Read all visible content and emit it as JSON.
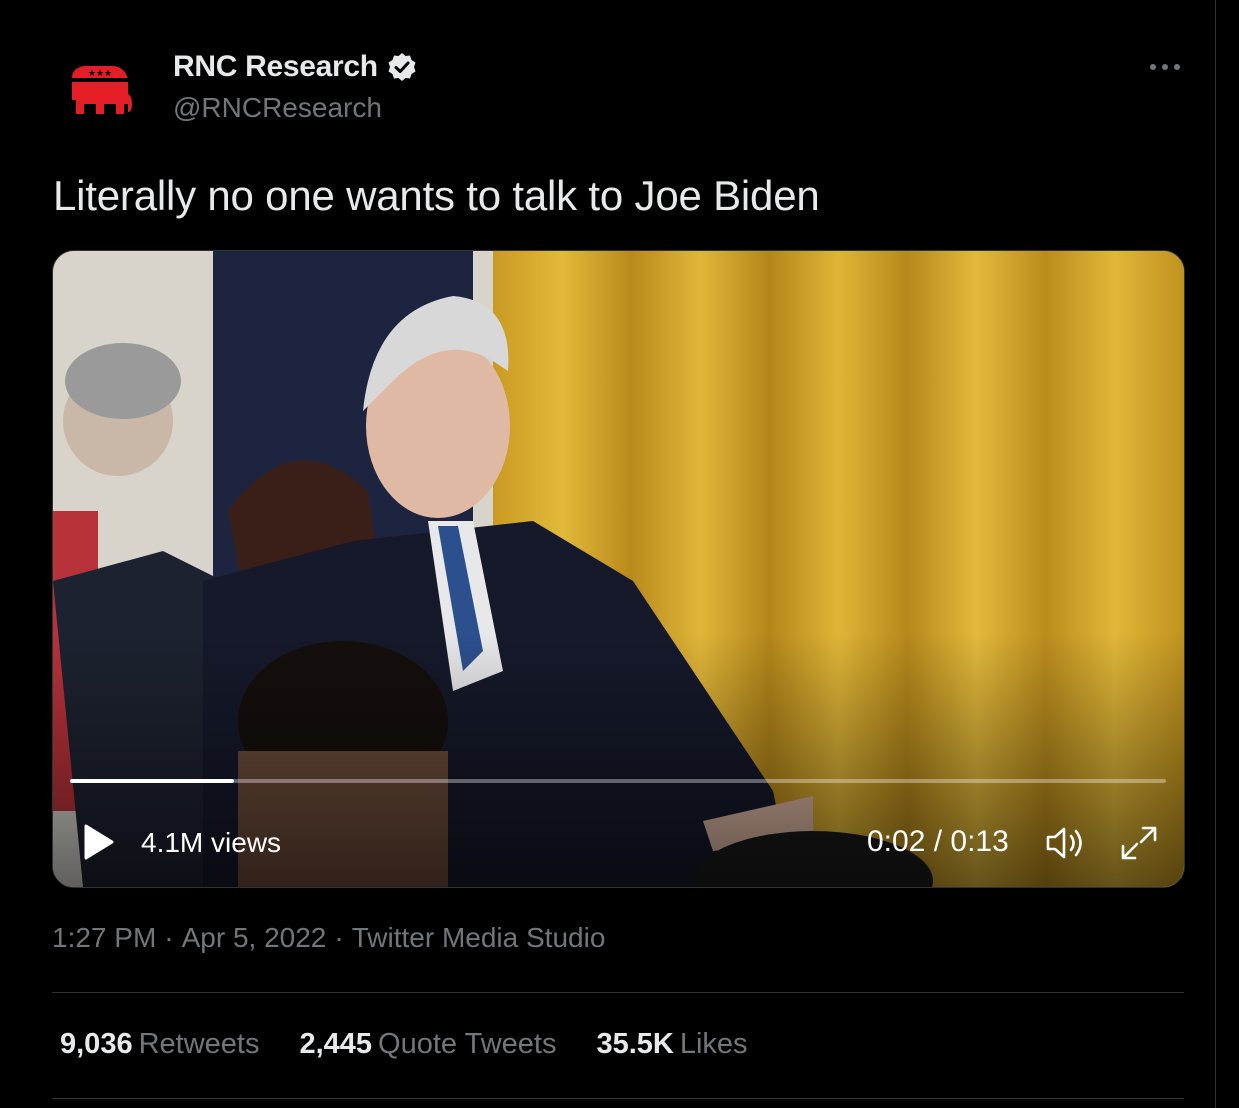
{
  "author": {
    "display_name": "RNC Research",
    "handle": "@RNCResearch",
    "verified": true,
    "avatar_icon": "gop-elephant-icon"
  },
  "tweet": {
    "text": "Literally no one wants to talk to Joe Biden"
  },
  "video": {
    "views": "4.1M views",
    "time": "0:02 / 0:13",
    "progress": 0.15
  },
  "meta": {
    "time": "1:27 PM",
    "separator": "·",
    "date": "Apr 5, 2022",
    "source": "Twitter Media Studio"
  },
  "stats": {
    "retweets_count": "9,036",
    "retweets_label": "Retweets",
    "quotes_count": "2,445",
    "quotes_label": "Quote Tweets",
    "likes_count": "35.5K",
    "likes_label": "Likes"
  },
  "colors": {
    "background": "#000000",
    "text_primary": "#e7e9ea",
    "text_secondary": "#71767b",
    "divider": "#2f3336",
    "brand_red": "#e41e26"
  }
}
